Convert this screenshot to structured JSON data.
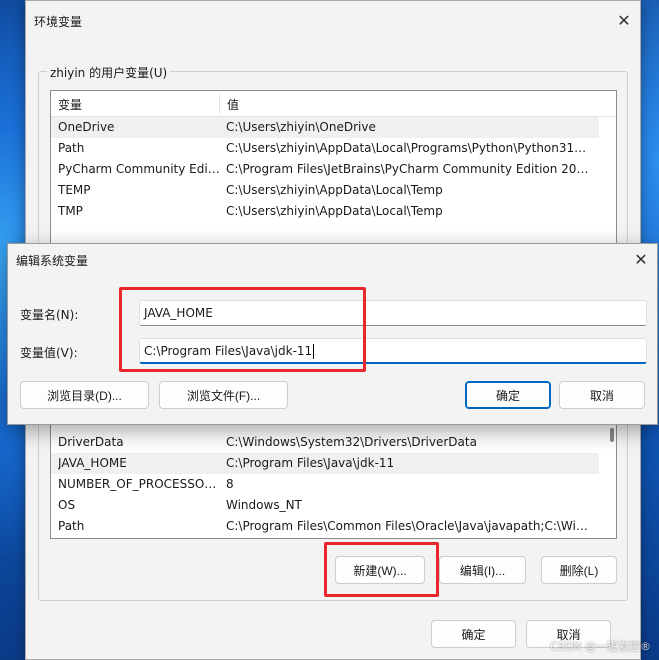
{
  "main_window": {
    "title": "环境变量",
    "user_vars_group_label": "zhiyin 的用户变量(U)",
    "columns": {
      "name": "变量",
      "value": "值"
    },
    "user_vars": [
      {
        "name": "OneDrive",
        "value": "C:\\Users\\zhiyin\\OneDrive"
      },
      {
        "name": "Path",
        "value": "C:\\Users\\zhiyin\\AppData\\Local\\Programs\\Python\\Python310\\..."
      },
      {
        "name": "PyCharm Community Editi...",
        "value": "C:\\Program Files\\JetBrains\\PyCharm Community Edition 2024..."
      },
      {
        "name": "TEMP",
        "value": "C:\\Users\\zhiyin\\AppData\\Local\\Temp"
      },
      {
        "name": "TMP",
        "value": "C:\\Users\\zhiyin\\AppData\\Local\\Temp"
      }
    ],
    "system_vars": [
      {
        "name": "DriverData",
        "value": "C:\\Windows\\System32\\Drivers\\DriverData"
      },
      {
        "name": "JAVA_HOME",
        "value": "C:\\Program Files\\Java\\jdk-11"
      },
      {
        "name": "NUMBER_OF_PROCESSORS",
        "value": "8"
      },
      {
        "name": "OS",
        "value": "Windows_NT"
      },
      {
        "name": "Path",
        "value": "C:\\Program Files\\Common Files\\Oracle\\Java\\javapath;C:\\Win..."
      }
    ],
    "system_buttons": {
      "new": "新建(W)...",
      "edit": "编辑(I)...",
      "delete": "删除(L)"
    },
    "ok": "确定",
    "cancel": "取消"
  },
  "edit_dialog": {
    "title": "编辑系统变量",
    "name_label": "变量名(N):",
    "name_value": "JAVA_HOME",
    "value_label": "变量值(V):",
    "value_value": "C:\\Program Files\\Java\\jdk-11",
    "browse_dir": "浏览目录(D)...",
    "browse_file": "浏览文件(F)...",
    "ok": "确定",
    "cancel": "取消"
  },
  "watermark": "CSDN @一短发控®",
  "colors": {
    "highlight": "#e8262b",
    "accent": "#0067c0"
  }
}
